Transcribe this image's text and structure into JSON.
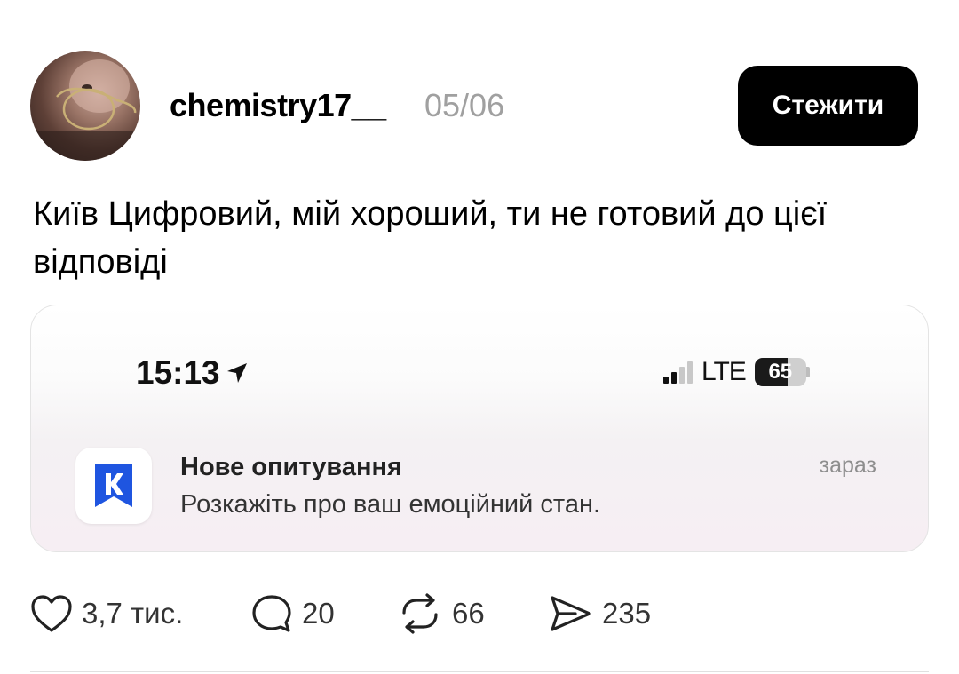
{
  "post": {
    "username": "chemistry17__",
    "date": "05/06",
    "follow_label": "Стежити",
    "text": "Київ Цифровий, мій хороший, ти не готовий до цієї відповіді"
  },
  "screenshot": {
    "status_bar": {
      "time": "15:13",
      "network": "LTE",
      "battery": "65",
      "battery_level": 0.65
    },
    "notification": {
      "title": "Нове опитування",
      "body": "Розкажіть про ваш емоційний стан.",
      "time": "зараз",
      "app_icon": "kyiv-digital-app-icon",
      "app_color": "#1f55e0"
    }
  },
  "actions": {
    "likes": "3,7 тис.",
    "replies": "20",
    "reposts": "66",
    "shares": "235"
  }
}
